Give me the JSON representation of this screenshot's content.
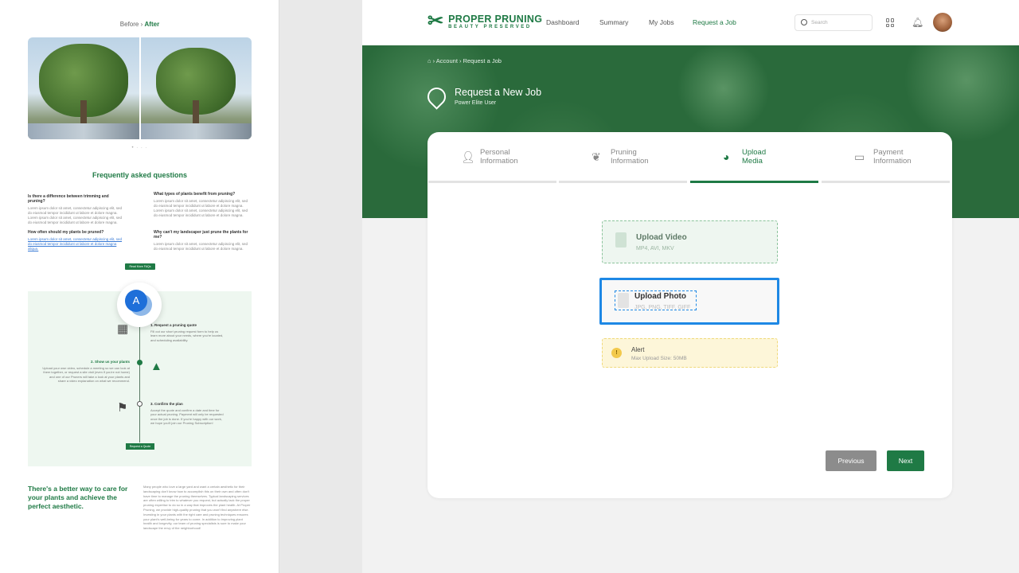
{
  "left": {
    "before_label": "Before",
    "sep": "›",
    "after_label": "After",
    "dots": "• · · ·",
    "faq_title": "Frequently asked questions",
    "faqs": [
      {
        "q": "Is there a difference between trimming and pruning?",
        "a": "Lorem ipsum dolor sit amet, consectetur adipiscing elit, sed do eiusmod tempor incididunt ut labore et dolore magna. Lorem ipsum dolor sit amet, consectetur adipiscing elit, sed do eiusmod tempor incididunt ut labore et dolore magna."
      },
      {
        "q": "What types of plants benefit from pruning?",
        "a": "Lorem ipsum dolor sit amet, consectetur adipiscing elit, sed do eiusmod tempor incididunt ut labore et dolore magna. Lorem ipsum dolor sit amet, consectetur adipiscing elit, sed do eiusmod tempor incididunt ut labore et dolore magna."
      },
      {
        "q": "How often should my plants be pruned?",
        "a": "Lorem ipsum dolor sit amet, consectetur adipiscing elit, sed do eiusmod tempor incididunt ut labore et dolore magna aliqua."
      },
      {
        "q": "Why can't my landscaper just prune the plants for me?",
        "a": "Lorem ipsum dolor sit amet, consectetur adipiscing elit, sed do eiusmod tempor incididunt ut labore et dolore magna."
      }
    ],
    "read_more": "Read More FAQs",
    "avatar_letter": "A",
    "steps": [
      {
        "title": "1. Request a pruning quote",
        "text": "Fill out our short pruning request form to help us learn more about your needs, where you're located, and scheduling availability."
      },
      {
        "title": "2. Show us your plants",
        "text": "Upload your own video, schedule a meeting so we can look at them together, or request a site visit (even if you're not home) and one of our Pruners will take a look at your plants and share a video explanation on what we recommend."
      },
      {
        "title": "3. Confirm the plan",
        "text": "Accept the quote and confirm a date and time for your actual pruning. Payment will only be requested once the job is done. If you're happy with our work, we hope you'll join our Pruning Subscription!"
      }
    ],
    "request_quote": "Request a Quote",
    "better_title": "There's a better way to care for your plants and achieve the perfect aesthetic.",
    "better_text": "Many people who love a large yard and want a certain aesthetic for their landscaping don't know how to accomplish this on their own and often don't have time to manage the pruning themselves. Typical landscaping services are often willing to trim to whatever you request, but actually lack the proper pruning expertise to do so in a way that improves the plant health. At Proper Pruning, we provide high-quality pruning that you won't find anywhere else. Investing in your plants with the right care and pruning techniques ensures your plant's well-being for years to come. In addition to improving plant health and longevity, our team of pruning specialists is sure to make your landscape the envy of the neighborhood!"
  },
  "app": {
    "logo_title": "PROPER PRUNING",
    "logo_sub": "BEAUTY PRESERVED",
    "nav": [
      "Dashboard",
      "Summary",
      "My Jobs",
      "Request a Job"
    ],
    "search_placeholder": "Search",
    "breadcrumb": [
      "Account",
      "Request a Job"
    ],
    "title": "Request a New Job",
    "subtitle": "Power Elite User",
    "tabs": [
      {
        "l1": "Personal",
        "l2": "Information",
        "icon": "person-icon"
      },
      {
        "l1": "Pruning",
        "l2": "Information",
        "icon": "leaves-icon"
      },
      {
        "l1": "Upload",
        "l2": "Media",
        "icon": "pie-icon"
      },
      {
        "l1": "Payment",
        "l2": "Information",
        "icon": "credit-card-icon"
      }
    ],
    "active_tab": 2,
    "upload_video": {
      "title": "Upload Video",
      "formats": "MP4, AVI, MKV"
    },
    "upload_photo": {
      "title": "Upload Photo",
      "formats": "JPG, PNG, TIFF, GIFF"
    },
    "alert": {
      "title": "Alert",
      "text": "Max Upload Size: 50MB"
    },
    "prev": "Previous",
    "next": "Next"
  },
  "colors": {
    "brand": "#1f7a45",
    "focus": "#1e88e5",
    "alert": "#f2c94c"
  }
}
